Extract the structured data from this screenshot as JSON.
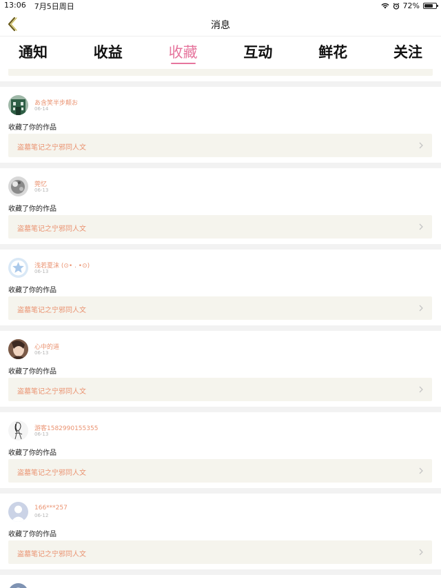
{
  "status_bar": {
    "time": "13:06",
    "date": "7月5日周日",
    "battery": "72%",
    "battery_level": 0.72
  },
  "nav": {
    "title": "消息",
    "back_icon": "chevron-left-icon"
  },
  "tabs": [
    {
      "label": "通知",
      "active": false
    },
    {
      "label": "收益",
      "active": false
    },
    {
      "label": "收藏",
      "active": true
    },
    {
      "label": "互动",
      "active": false
    },
    {
      "label": "鲜花",
      "active": false
    },
    {
      "label": "关注",
      "active": false
    }
  ],
  "colors": {
    "accent_pink": "#e6759d",
    "username_orange": "#ea9270",
    "link_background": "#f5f4ed"
  },
  "items": [
    {
      "username": "あ含笑半步颠お",
      "date": "06-14",
      "action": "收藏了你的作品",
      "work": "盗墓笔记之宁邪同人文",
      "avatar": "avatar-building-green"
    },
    {
      "username": "莞忆",
      "date": "06-13",
      "action": "收藏了你的作品",
      "work": "盗墓笔记之宁邪同人文",
      "avatar": "avatar-grayscale"
    },
    {
      "username": "浅若夏沫 (⊙• . •⊙)",
      "date": "06-13",
      "action": "收藏了你的作品",
      "work": "盗墓笔记之宁邪同人文",
      "avatar": "avatar-default-star"
    },
    {
      "username": "心中的道",
      "date": "06-13",
      "action": "收藏了你的作品",
      "work": "盗墓笔记之宁邪同人文",
      "avatar": "avatar-photo-girl"
    },
    {
      "username": "游客1582990155355",
      "date": "06-13",
      "action": "收藏了你的作品",
      "work": "盗墓笔记之宁邪同人文",
      "avatar": "avatar-sketch"
    },
    {
      "username": "166***257",
      "date": "06-12",
      "action": "收藏了你的作品",
      "work": "盗墓笔记之宁邪同人文",
      "avatar": "avatar-default-person"
    }
  ]
}
